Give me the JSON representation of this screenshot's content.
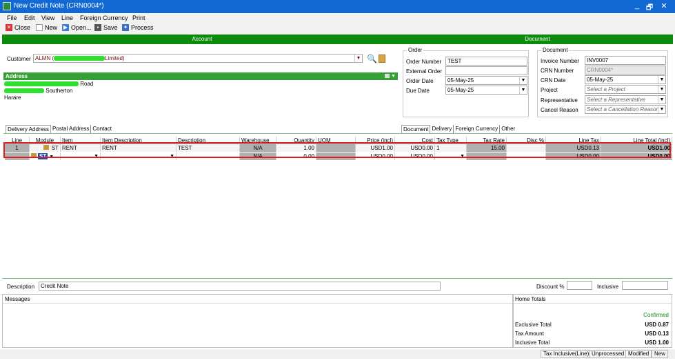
{
  "window": {
    "title": "New Credit Note (CRN0004*)",
    "minimize": "_",
    "restore": "🗗",
    "close": "✕"
  },
  "menu": [
    "File",
    "Edit",
    "View",
    "Line",
    "Foreign Currency",
    "Print"
  ],
  "toolbar": {
    "close": "Close",
    "new": "New",
    "open": "Open...",
    "save": "Save",
    "process": "Process"
  },
  "sections": {
    "account": "Account",
    "document": "Document"
  },
  "customer": {
    "label": "Customer",
    "code": "ALMN (",
    "name_end": "Limited)"
  },
  "address": {
    "header": "Address",
    "line1": "Road",
    "line2": "Southerton",
    "line3": "Harare"
  },
  "order": {
    "caption": "Order",
    "order_number_label": "Order Number",
    "order_number": "TEST",
    "external_order_label": "External Order",
    "external_order": "",
    "order_date_label": "Order Date",
    "order_date": "05-May-25",
    "due_date_label": "Due Date",
    "due_date": "05-May-25"
  },
  "document": {
    "caption": "Document",
    "invoice_number_label": "Invoice Number",
    "invoice_number": "INV0007",
    "crn_number_label": "CRN Number",
    "crn_number": "CRN0004*",
    "crn_date_label": "CRN Date",
    "crn_date": "05-May-25",
    "project_label": "Project",
    "project_placeholder": "Select a Project",
    "rep_label": "Representative",
    "rep_placeholder": "Select a Representative",
    "cancel_label": "Cancel Reason",
    "cancel_placeholder": "Select a Cancellation Reason"
  },
  "left_tabs": [
    "Delivery Address",
    "Postal Address",
    "Contact"
  ],
  "right_tabs": [
    "Document",
    "Delivery",
    "Foreign Currency",
    "Other"
  ],
  "grid": {
    "columns": [
      "Line",
      "Module",
      "Item",
      "Item Description",
      "Description",
      "Warehouse",
      "Quantity",
      "UOM",
      "Price (incl)",
      "Cost",
      "Tax Type",
      "Tax Rate",
      "Disc %",
      "Line Tax",
      "Line Total (incl)"
    ],
    "rows": [
      {
        "line": "1",
        "module": "ST",
        "item": "RENT",
        "item_desc": "RENT",
        "desc": "TEST",
        "warehouse": "N/A",
        "qty": "1.00",
        "uom": "",
        "price": "USD1.00",
        "cost": "USD0.00",
        "tax_type": "1",
        "tax_rate": "15.00",
        "disc": "",
        "line_tax": "USD0.13",
        "total": "USD1.00"
      },
      {
        "line": "",
        "module": "ST",
        "item": "",
        "item_desc": "",
        "desc": "",
        "warehouse": "N/A",
        "qty": "0.00",
        "uom": "",
        "price": "USD0.00",
        "cost": "USD0.00",
        "tax_type": "",
        "tax_rate": "",
        "disc": "",
        "line_tax": "USD0.00",
        "total": "USD0.00"
      }
    ]
  },
  "footer": {
    "description_label": "Description",
    "description": "Credit Note",
    "discount_label": "Discount %",
    "discount": "",
    "inclusive_label": "Inclusive",
    "inclusive": "",
    "messages": "Messages",
    "home_totals": "Home Totals",
    "status": "Confirmed",
    "exclusive_label": "Exclusive Total",
    "exclusive": "USD 0.87",
    "tax_label": "Tax Amount",
    "tax": "USD 0.13",
    "inclusive_total_label": "Inclusive Total",
    "inclusive_total": "USD 1.00"
  },
  "statusbar": [
    "Tax Inclusive(Line)",
    "Unprocessed",
    "Modified",
    "New"
  ],
  "colors": {
    "title": "#1369d4",
    "section": "#0b8a0b",
    "highlight_border": "#d42020",
    "confirmed": "#0a8a0a"
  }
}
